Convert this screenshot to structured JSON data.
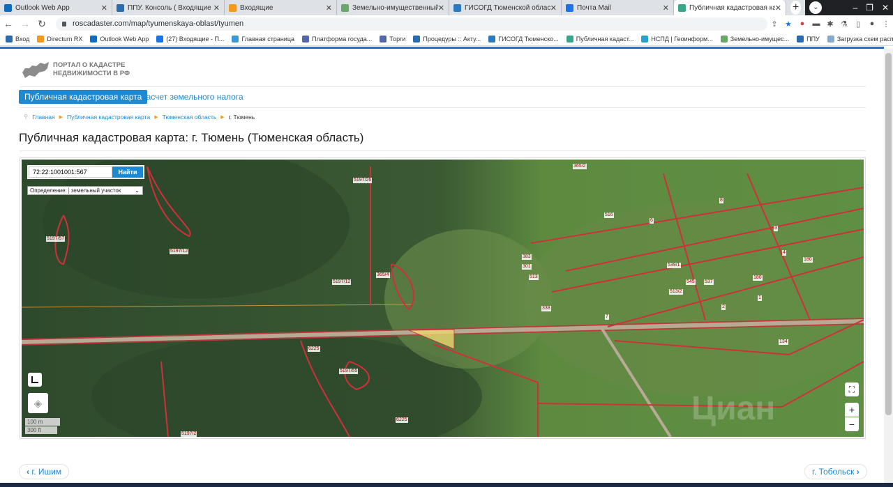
{
  "browser": {
    "tabs": [
      {
        "label": "Outlook Web App",
        "color": "#0f6cbd"
      },
      {
        "label": "ППУ. Консоль ( Входящие )",
        "color": "#2b6cb0"
      },
      {
        "label": "Входящие",
        "color": "#f39a1e"
      },
      {
        "label": "Земельно-имущественный ком",
        "color": "#6aa86a"
      },
      {
        "label": "ГИСОГД Тюменской области",
        "color": "#2a79c2"
      },
      {
        "label": "Почта Mail",
        "color": "#1a73e8"
      },
      {
        "label": "Публичная кадастровая карта",
        "color": "#3aa58a",
        "active": true
      }
    ],
    "url": "roscadaster.com/map/tyumenskaya-oblast/tyumen",
    "bookmarks": [
      {
        "label": "Вход",
        "color": "#2b6cb0"
      },
      {
        "label": "Directum RX",
        "color": "#f39a1e"
      },
      {
        "label": "Outlook Web App",
        "color": "#0f6cbd"
      },
      {
        "label": "(27) Входящие - П...",
        "color": "#1a73e8"
      },
      {
        "label": "Главная страница",
        "color": "#3a9ad9"
      },
      {
        "label": "Платформа госуда...",
        "color": "#5566aa"
      },
      {
        "label": "Торги",
        "color": "#5566aa"
      },
      {
        "label": "Процедуры :: Акту...",
        "color": "#2b6cb0"
      },
      {
        "label": "ГИСОГД Тюменско...",
        "color": "#2a79c2"
      },
      {
        "label": "Публичная кадаст...",
        "color": "#3aa58a"
      },
      {
        "label": "НСПД | Геоинформ...",
        "color": "#2aa0d0"
      },
      {
        "label": "Земельно-имущес...",
        "color": "#6aa86a"
      },
      {
        "label": "ППУ",
        "color": "#2b6cb0"
      },
      {
        "label": "Загрузка схем расп...",
        "color": "#88aacc"
      }
    ],
    "more": "»"
  },
  "site": {
    "logo_line1": "ПОРТАЛ О КАДАСТРЕ",
    "logo_line2": "НЕДВИЖИМОСТИ В РФ",
    "nav_active": "Публичная кадастровая карта",
    "nav_link": "Расчет земельного налога",
    "breadcrumb": [
      "Главная",
      "Публичная кадастровая карта",
      "Тюменская область",
      "г. Тюмень"
    ],
    "title": "Публичная кадастровая карта: г. Тюмень (Тюменская область)"
  },
  "map": {
    "search_value": "72:22:1001001:567",
    "search_button": "Найти",
    "definition_label": "Определение:",
    "definition_value": "земельный участок",
    "scale_m": "100 m",
    "scale_ft": "300 ft",
    "zoom_in": "+",
    "zoom_out": "−",
    "watermark": "Циан",
    "parcels": [
      "5197/26",
      "5197/12",
      "5197/12",
      "365/4",
      "365/2",
      "5197/57",
      "5197/55",
      "6225",
      "5197/2",
      "6225",
      "180",
      "180",
      "513/2",
      "539/1",
      "545",
      "537",
      "1",
      "2",
      "3",
      "4",
      "6",
      "7",
      "8",
      "134",
      "516",
      "338",
      "301",
      "383",
      "513"
    ]
  },
  "pager": {
    "prev": "г. Ишим",
    "next": "г. Тобольск"
  }
}
